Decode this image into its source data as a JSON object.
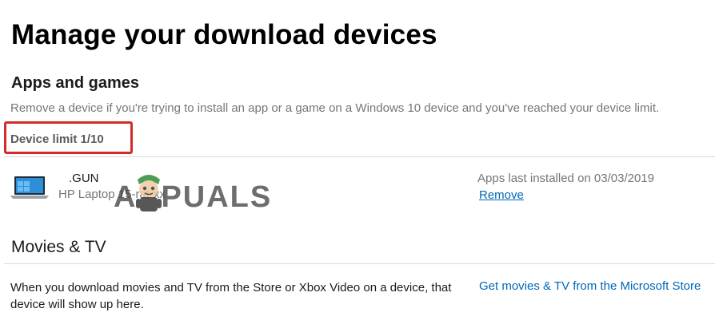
{
  "page": {
    "title": "Manage your download devices"
  },
  "apps": {
    "title": "Apps and games",
    "description": "Remove a device if you're trying to install an app or a game on a Windows 10 device and you've reached your device limit.",
    "device_limit": "Device limit 1/10",
    "device": {
      "icon": "laptop-icon",
      "name": ".GUN",
      "model": "HP Laptop 15-rat-xx",
      "last_installed": "Apps last installed on 03/03/2019",
      "remove_label": "Remove"
    }
  },
  "movies": {
    "title": "Movies & TV",
    "description": "When you download movies and TV from the Store or Xbox Video on a device, that device will show up here.",
    "store_link": "Get movies & TV from the Microsoft Store"
  },
  "watermark": {
    "letters_left": "A",
    "letters_right": "PUALS"
  },
  "colors": {
    "link": "#0067b8",
    "highlight_box": "#d12b2b",
    "muted_text": "#767676"
  }
}
